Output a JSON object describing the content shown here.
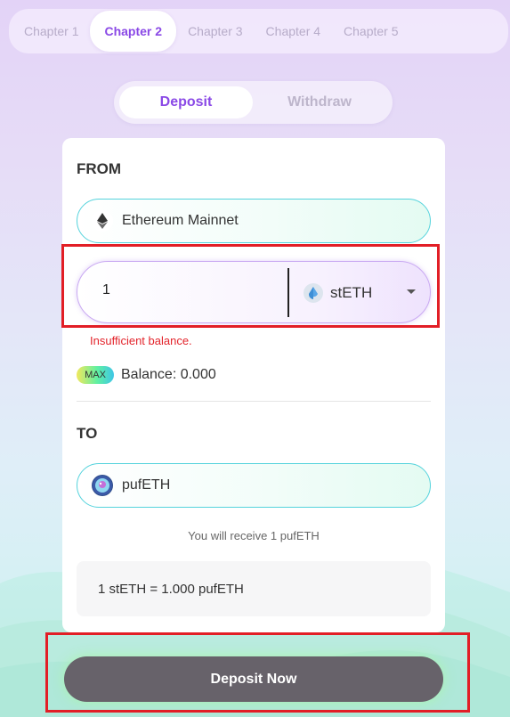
{
  "chapters": [
    "Chapter 1",
    "Chapter 2",
    "Chapter 3",
    "Chapter 4",
    "Chapter 5"
  ],
  "active_chapter": 1,
  "modes": {
    "deposit": "Deposit",
    "withdraw": "Withdraw",
    "active": "deposit"
  },
  "from": {
    "label": "FROM",
    "network": "Ethereum Mainnet",
    "network_icon": "ethereum-icon",
    "amount": "1",
    "token": "stETH",
    "token_icon": "steth-icon",
    "error": "Insufficient balance.",
    "max_label": "MAX",
    "balance": "Balance: 0.000"
  },
  "to": {
    "label": "TO",
    "token": "pufETH",
    "token_icon": "pufeth-icon",
    "receive_note": "You will receive 1 pufETH",
    "rate": "1 stETH = 1.000 pufETH"
  },
  "cta": {
    "label": "Deposit Now"
  },
  "colors": {
    "accent": "#8a49e6",
    "error": "#e3242b",
    "highlight": "#e21e26",
    "cta_bg": "#67626a",
    "pill_border": "#55d3dc"
  }
}
